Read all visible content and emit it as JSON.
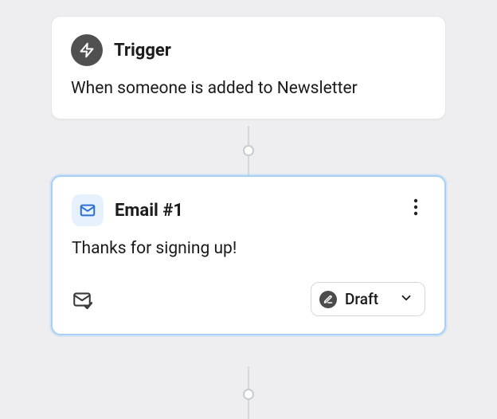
{
  "trigger": {
    "title": "Trigger",
    "description": "When someone is added to Newsletter"
  },
  "email": {
    "title": "Email #1",
    "subject": "Thanks for signing up!",
    "status_label": "Draft"
  },
  "icons": {
    "trigger": "lightning-icon",
    "email": "mail-icon",
    "a_b": "ab-test-icon",
    "status_dot": "pencil-icon",
    "chevron": "chevron-down-icon",
    "kebab": "more-vertical-icon"
  },
  "colors": {
    "canvas_bg": "#eeeef0",
    "card_bg": "#ffffff",
    "card_border": "#e4e6ea",
    "selected_border": "#a7cff5",
    "trigger_icon_bg": "#505050",
    "email_icon_bg": "#e7f1fd",
    "email_icon_fg": "#2b6fd6",
    "status_dot_bg": "#4b4b4b"
  }
}
